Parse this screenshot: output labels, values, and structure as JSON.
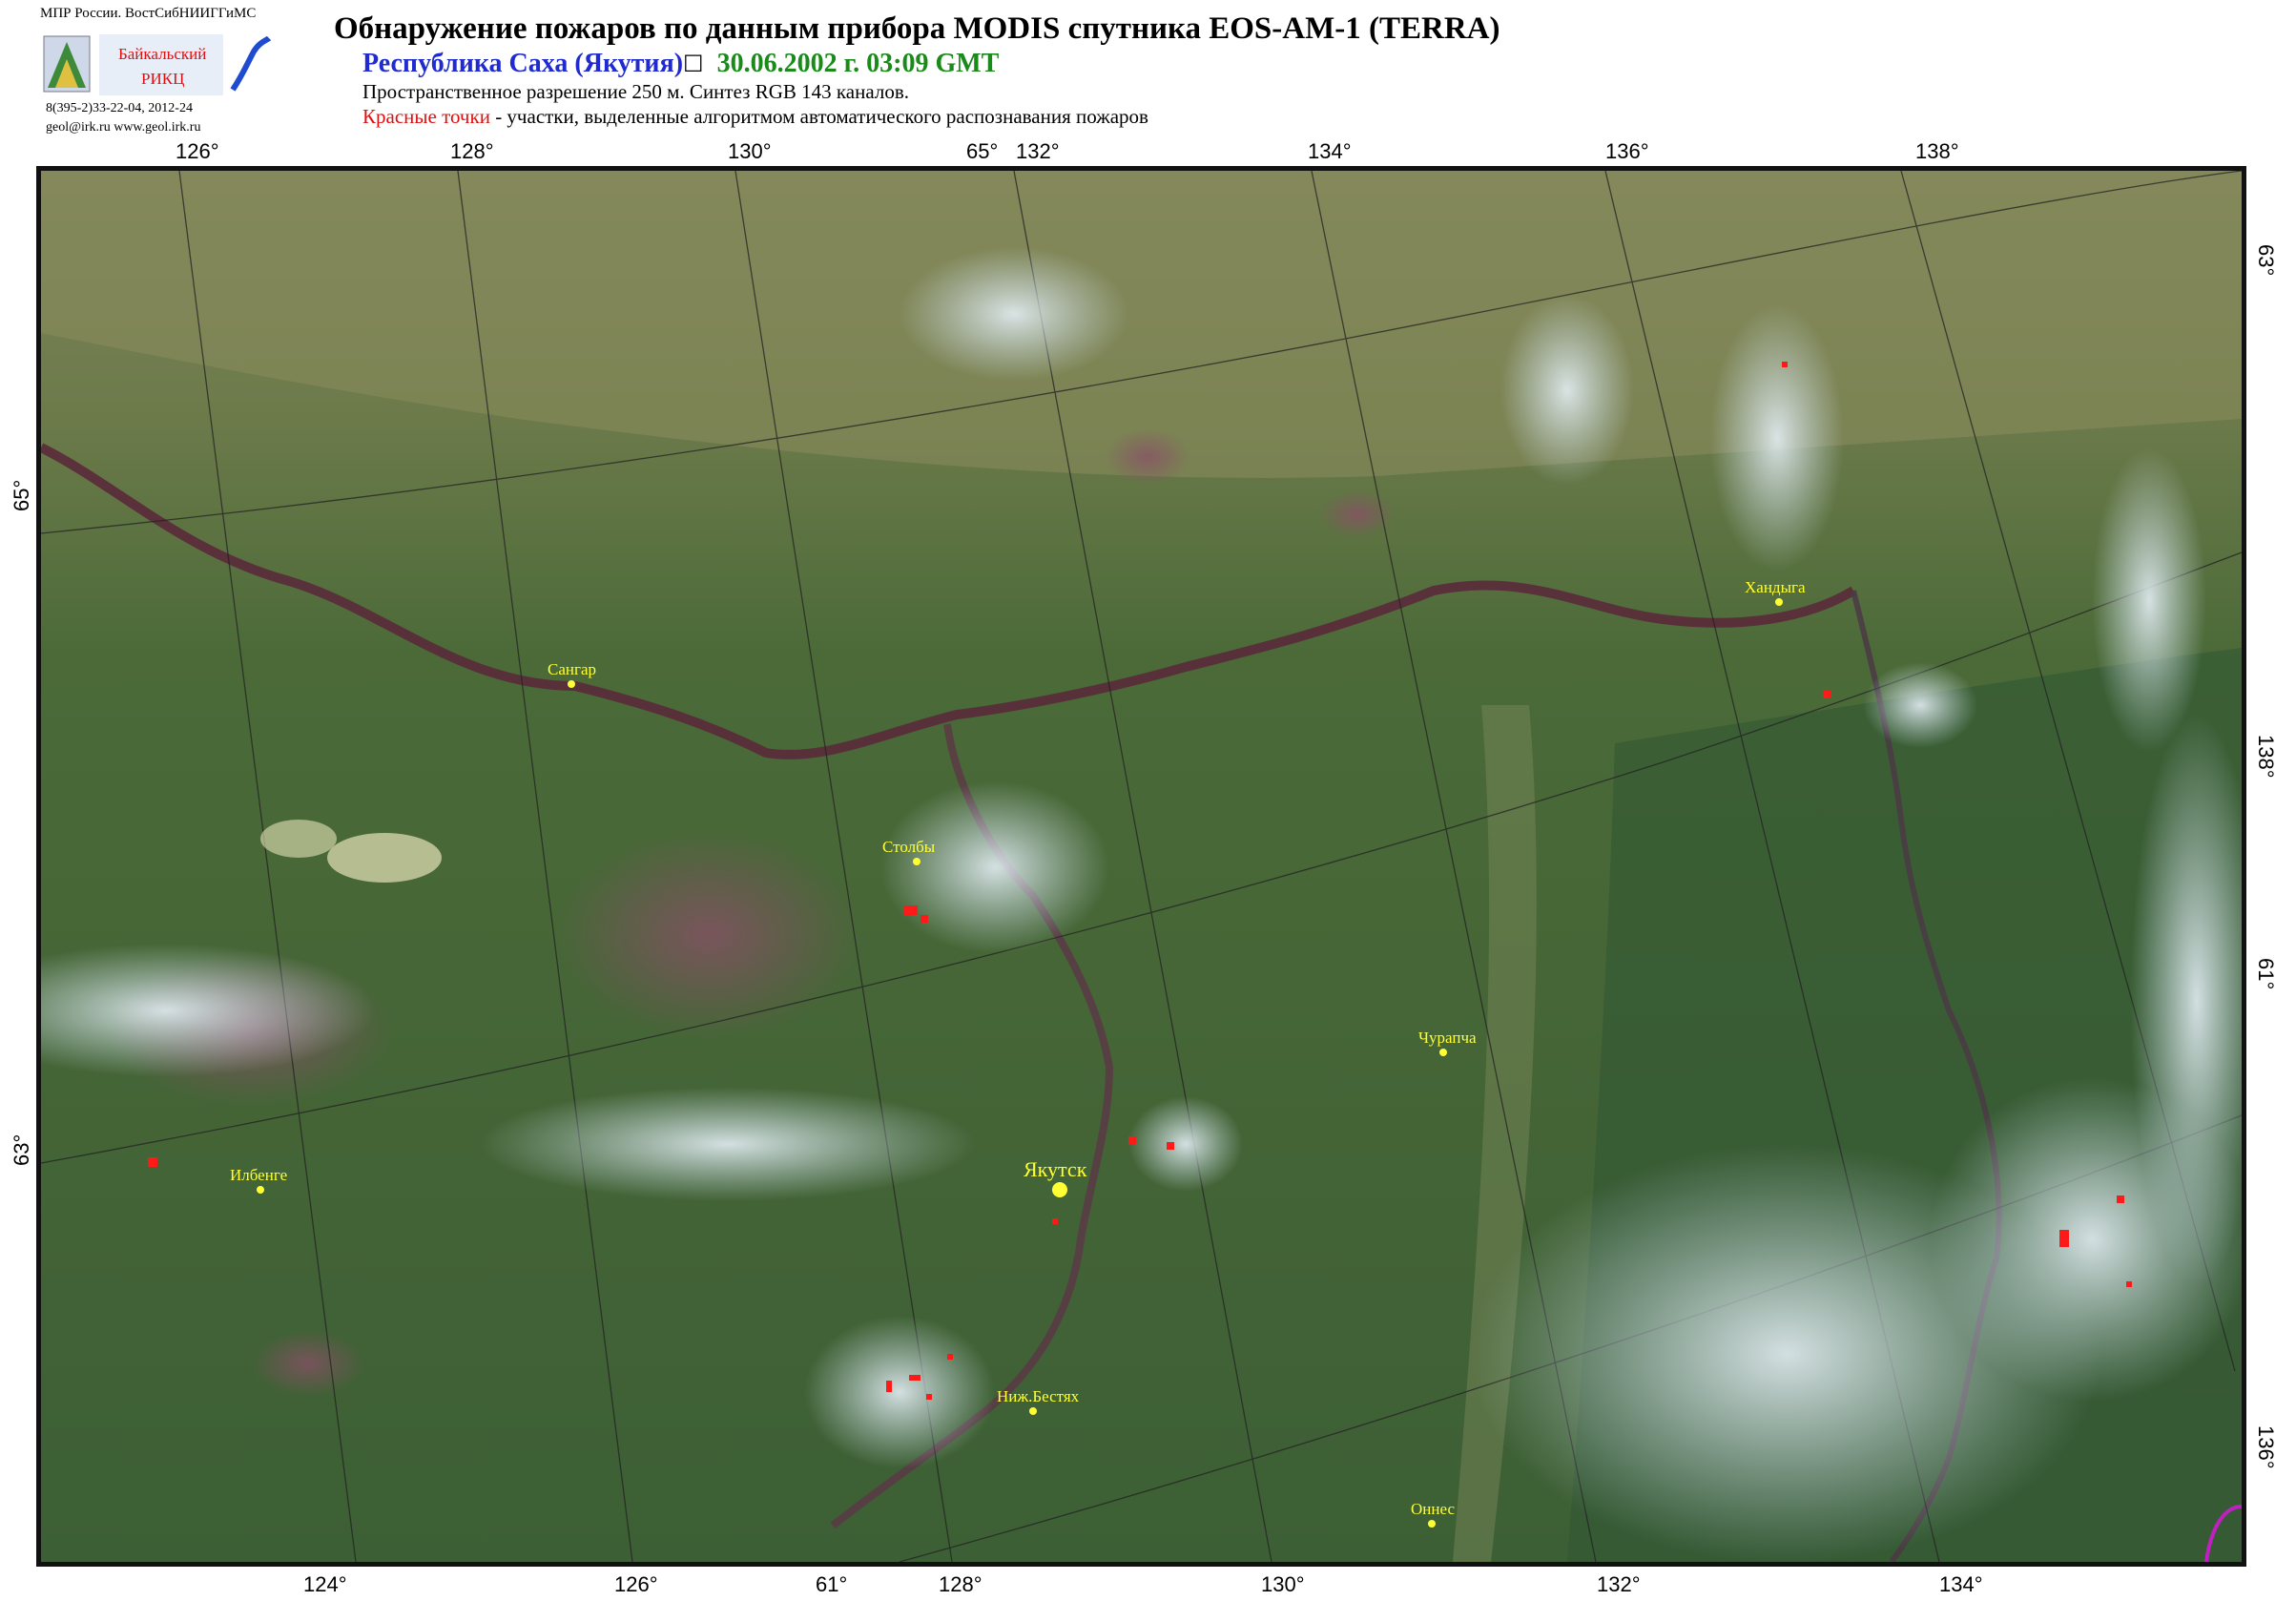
{
  "header": {
    "org": "МПР России. ВостСибНИИГГиМС",
    "logo_text_1": "Байкальский",
    "logo_text_2": "РИКЦ",
    "phone": "8(395-2)33-22-04, 2012-24",
    "contacts": "geol@irk.ru  www.geol.irk.ru",
    "title": "Обнаружение пожаров по данным прибора MODIS спутника EOS-AM-1 (TERRA)",
    "region": "Республика Саха (Якутия)",
    "datetime": "30.06.2002 г. 03:09 GMT",
    "resolution": "Пространственное разрешение 250 м. Синтез RGB 143 каналов.",
    "legend_red": "Красные точки",
    "legend_rest": " - участки, выделенные алгоритмом автоматического распознавания пожаров"
  },
  "ticks": {
    "top": [
      "126°",
      "128°",
      "130°",
      "65°",
      "132°",
      "134°",
      "136°",
      "138°"
    ],
    "bottom": [
      "124°",
      "126°",
      "61°",
      "128°",
      "130°",
      "132°",
      "134°"
    ],
    "left": [
      "65°",
      "63°"
    ],
    "right": [
      "63°",
      "138°",
      "61°",
      "136°"
    ]
  },
  "towns": [
    {
      "name": "Сангар"
    },
    {
      "name": "Хандыга"
    },
    {
      "name": "Столбы"
    },
    {
      "name": "Чурапча"
    },
    {
      "name": "Якутск"
    },
    {
      "name": "Илбенге"
    },
    {
      "name": "Ниж.Бестях"
    },
    {
      "name": "Оннес"
    }
  ],
  "colors": {
    "fire": "#ff1a1a",
    "town": "#ffff33",
    "forest": "#3f6b32",
    "mountain": "#8a8a5a",
    "river": "#5a2a3a",
    "smoke": "#c8dce8",
    "border": "#c020c0"
  }
}
